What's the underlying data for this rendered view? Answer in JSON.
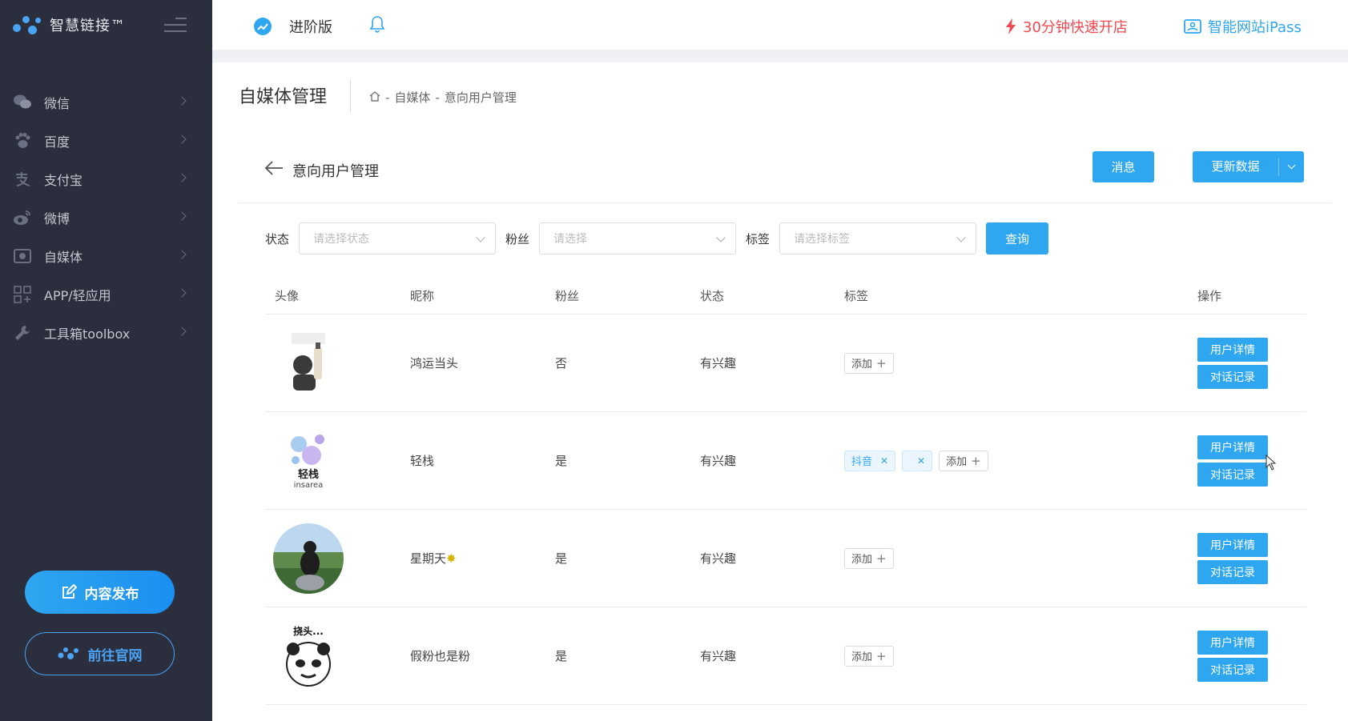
{
  "sidebar": {
    "logo_text": "智慧链接™",
    "items": [
      {
        "label": "微信",
        "icon": "wechat-icon"
      },
      {
        "label": "百度",
        "icon": "paw-icon"
      },
      {
        "label": "支付宝",
        "icon": "alipay-icon"
      },
      {
        "label": "微博",
        "icon": "weibo-icon"
      },
      {
        "label": "自媒体",
        "icon": "media-icon"
      },
      {
        "label": "APP/轻应用",
        "icon": "apps-icon"
      },
      {
        "label": "工具箱toolbox",
        "icon": "wrench-icon"
      }
    ],
    "publish_label": "内容发布",
    "official_label": "前往官网"
  },
  "topbar": {
    "edition": "进阶版",
    "quick_open": "30分钟快速开店",
    "ipass": "智能网站iPass"
  },
  "header": {
    "title": "自媒体管理",
    "breadcrumb": [
      "自媒体",
      "意向用户管理"
    ]
  },
  "subheader": {
    "title": "意向用户管理",
    "message_label": "消息",
    "update_label": "更新数据"
  },
  "filters": {
    "status_label": "状态",
    "status_placeholder": "请选择状态",
    "fans_label": "粉丝",
    "fans_placeholder": "请选择",
    "tags_label": "标签",
    "tags_placeholder": "请选择标签",
    "query_label": "查询"
  },
  "table": {
    "columns": [
      "头像",
      "昵称",
      "粉丝",
      "状态",
      "标签",
      "操作"
    ],
    "add_label": "添加",
    "detail_label": "用户详情",
    "chat_label": "对话记录",
    "rows": [
      {
        "nick": "鸿运当头",
        "fans": "否",
        "status": "有兴趣",
        "tags": []
      },
      {
        "nick": "轻栈",
        "fans": "是",
        "status": "有兴趣",
        "tags": [
          "抖音",
          ""
        ],
        "avatar_text": "轻栈",
        "avatar_sub": "insarea"
      },
      {
        "nick": "星期天",
        "fans": "是",
        "status": "有兴趣",
        "tags": []
      },
      {
        "nick": "假粉也是粉",
        "fans": "是",
        "status": "有兴趣",
        "tags": [],
        "avatar_text": "挠头..."
      }
    ]
  },
  "colors": {
    "accent": "#2fa6f0",
    "sidebar_bg": "#2b2e3c",
    "alert": "#f5474f"
  }
}
